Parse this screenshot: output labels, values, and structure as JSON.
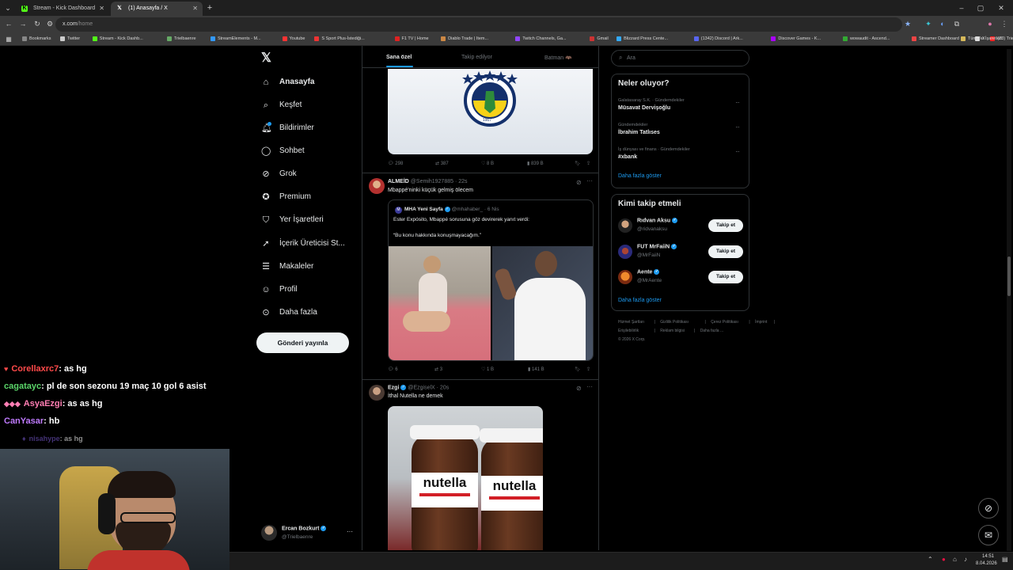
{
  "browser": {
    "tabs": [
      {
        "title": "Stream - Kick Dashboard",
        "icon": "kick-icon"
      },
      {
        "title": "(1) Anasayfa / X",
        "icon": "x-logo-icon"
      }
    ],
    "url_host": "x.com",
    "url_path": "/home",
    "bookmarks": [
      "Bookmarks",
      "Twitter",
      "Stream - Kick Dashb...",
      "Trielbaenre",
      "StreamElements - M...",
      "Youtube",
      "S Sport Plus-İstediği...",
      "F1 TV | Home",
      "Diablo Trade | Item...",
      "Twitch Channels, Ga...",
      "Gmail",
      "Blizzard Press Cente...",
      "(1342) Discord | Ark...",
      "Discover Games - K...",
      "wowaudit - Ascend...",
      "Streamer Dashboard",
      "X",
      "(23) Trielbaenre - Yo..."
    ],
    "all_bookmarks": "Tüm Yer İşaretleri"
  },
  "nav": {
    "items": [
      {
        "label": "Anasayfa",
        "icon": "home-icon"
      },
      {
        "label": "Keşfet",
        "icon": "search-icon"
      },
      {
        "label": "Bildirimler",
        "icon": "bell-icon"
      },
      {
        "label": "Sohbet",
        "icon": "chat-icon"
      },
      {
        "label": "Grok",
        "icon": "grok-icon"
      },
      {
        "label": "Premium",
        "icon": "premium-icon"
      },
      {
        "label": "Yer İşaretleri",
        "icon": "bookmark-icon"
      },
      {
        "label": "İçerik Üreticisi St...",
        "icon": "rocket-icon"
      },
      {
        "label": "Makaleler",
        "icon": "article-icon"
      },
      {
        "label": "Profil",
        "icon": "person-icon"
      },
      {
        "label": "Daha fazla",
        "icon": "more-circle-icon"
      }
    ],
    "post_button": "Gönderi yayınla",
    "account": {
      "name": "Ercan Bozkurt",
      "handle": "@Trielbaenre"
    }
  },
  "feed": {
    "tabs": [
      "Sana özel",
      "Takip edilyor",
      "Batman 🦇"
    ],
    "post1_actions": {
      "replies": "298",
      "reposts": "387",
      "likes": "8 B",
      "views": "839 B"
    },
    "post2": {
      "name": "ALMEİD",
      "handle": "@Semih1927885",
      "time": "22s",
      "text": "Mbappé'ninki küçük gelmiş ölecem",
      "quote_name": "MHA Yeni Sayfa",
      "quote_handle": "@mhahaber_",
      "quote_time": "6 Nis",
      "quote_text1": "Ester Expósito, Mbappé sorusuna göz devirerek yanıt verdi:",
      "quote_text2": "“Bu konu hakkında konuşmayacağım.”",
      "actions": {
        "replies": "6",
        "reposts": "3",
        "likes": "1 B",
        "views": "141 B"
      }
    },
    "post3": {
      "name": "Ezgi",
      "handle": "@EzgiselX",
      "time": "20s",
      "text": "İthal Nutella ne demek",
      "jar_label": "nutella"
    }
  },
  "right": {
    "search_placeholder": "Ara",
    "trends_title": "Neler oluyor?",
    "trends": [
      {
        "meta": "Galatasaray S.K. · Gündemdekiler",
        "title": "Müsavat Dervişoğlu"
      },
      {
        "meta": "Gündemdekiler",
        "title": "İbrahim Tatlıses"
      },
      {
        "meta": "İş dünyası ve finans · Gündemdekiler",
        "title": "#xbank"
      }
    ],
    "show_more": "Daha fazla göster",
    "follow_title": "Kimi takip etmeli",
    "follow": [
      {
        "name": "Rıdvan Aksu",
        "handle": "@ridvanaksu",
        "button": "Takip et"
      },
      {
        "name": "FUT MrFaiiN",
        "handle": "@MrFaiiN",
        "button": "Takip et"
      },
      {
        "name": "Aente",
        "handle": "@MrAente",
        "button": "Takip et"
      }
    ],
    "footer": [
      "Hizmet Şartları",
      "|",
      "Gizlilik Politikası",
      "|",
      "Çerez Politikası",
      "|",
      "İmprint",
      "|",
      "Erişilebilirlik",
      "|",
      "Reklam bilgisi",
      "|",
      "Daha fazla ...",
      "© 2026 X Corp."
    ]
  },
  "chat": [
    {
      "user": "Corellaxrc7",
      "msg": ": as hg",
      "color": "#ff4a4a",
      "badge": "♥"
    },
    {
      "user": "cagatayc",
      "msg": ": pl de son sezonu 19 maç 10 gol 6 asist",
      "color": "#5bd66a",
      "badge": ""
    },
    {
      "user": "AsyaEzgi",
      "msg": ": as as hg",
      "color": "#ff7eb3",
      "badge": "◆◆◆"
    },
    {
      "user": "CanYasar",
      "msg": ": hb",
      "color": "#c07bff",
      "badge": ""
    },
    {
      "user": "nisahype",
      "msg": ": as hg",
      "color": "#7b5bd6",
      "badge": "♦"
    }
  ],
  "taskbar": {
    "time": "14:51",
    "date": "8.04.2026"
  },
  "colors": {
    "accent": "#1d9bf0",
    "background": "#000000",
    "border": "#2f3336"
  }
}
